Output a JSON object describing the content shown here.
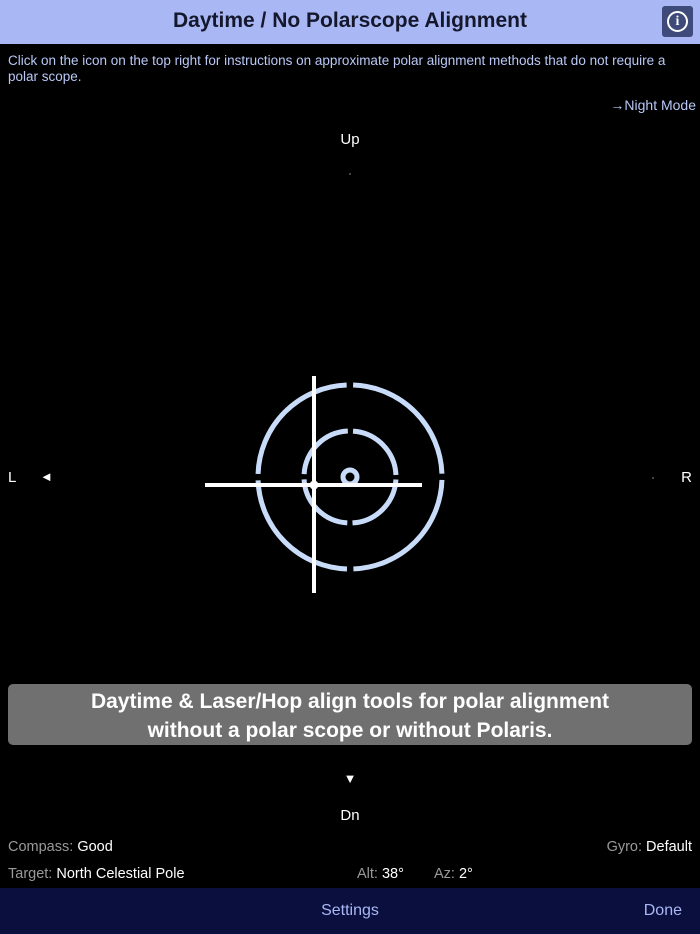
{
  "header": {
    "title": "Daytime / No Polarscope Alignment",
    "info_icon": "info-icon"
  },
  "instructions": "Click on the icon on the top right for instructions on approximate polar alignment methods that do not require a polar scope.",
  "night_mode_label": "→Night Mode",
  "directions": {
    "up": "Up",
    "down": "Dn",
    "left": "L",
    "right": "R"
  },
  "arrows": {
    "left": "◄",
    "down": "▼"
  },
  "reticle": {
    "color": "#c8dcfa"
  },
  "banner": {
    "line1": "Daytime & Laser/Hop align tools for polar alignment",
    "line2": "without a polar scope or without Polaris."
  },
  "status": {
    "compass_label": "Compass:",
    "compass_value": "Good",
    "gyro_label": "Gyro:",
    "gyro_value": "Default",
    "target_label": "Target:",
    "target_value": "North Celestial Pole",
    "alt_label": "Alt:",
    "alt_value": "38°",
    "az_label": "Az:",
    "az_value": "2°"
  },
  "toolbar": {
    "settings_label": "Settings",
    "done_label": "Done"
  },
  "colors": {
    "header_bg": "#a9b8f5",
    "accent_text": "#b9c8f7",
    "toolbar_bg": "#0b0f3d",
    "banner_bg": "#707070"
  }
}
